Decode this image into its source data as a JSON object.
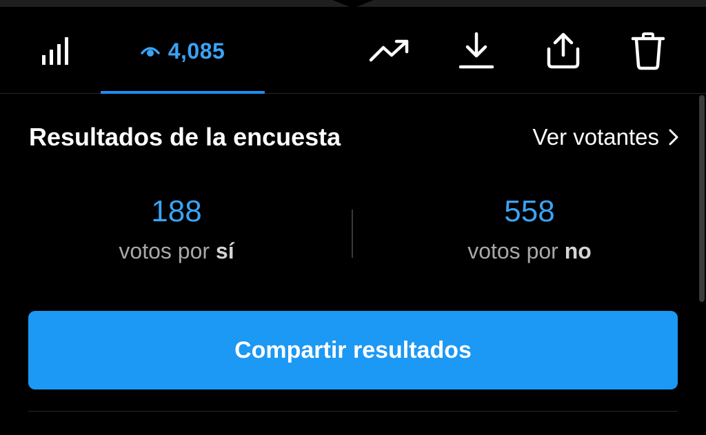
{
  "toolbar": {
    "views_count": "4,085",
    "active_tab": "views",
    "accent_color": "#3aa3f5",
    "icons": [
      "bar-chart-icon",
      "eye-icon",
      "trending-up-icon",
      "download-icon",
      "share-icon",
      "trash-icon"
    ]
  },
  "poll": {
    "title": "Resultados de la encuesta",
    "voters_link": "Ver votantes",
    "yes": {
      "count": "188",
      "caption_prefix": "votos por",
      "caption_emph": "sí"
    },
    "no": {
      "count": "558",
      "caption_prefix": "votos por",
      "caption_emph": "no"
    },
    "share_button": "Compartir resultados",
    "button_color": "#1c98f5"
  }
}
